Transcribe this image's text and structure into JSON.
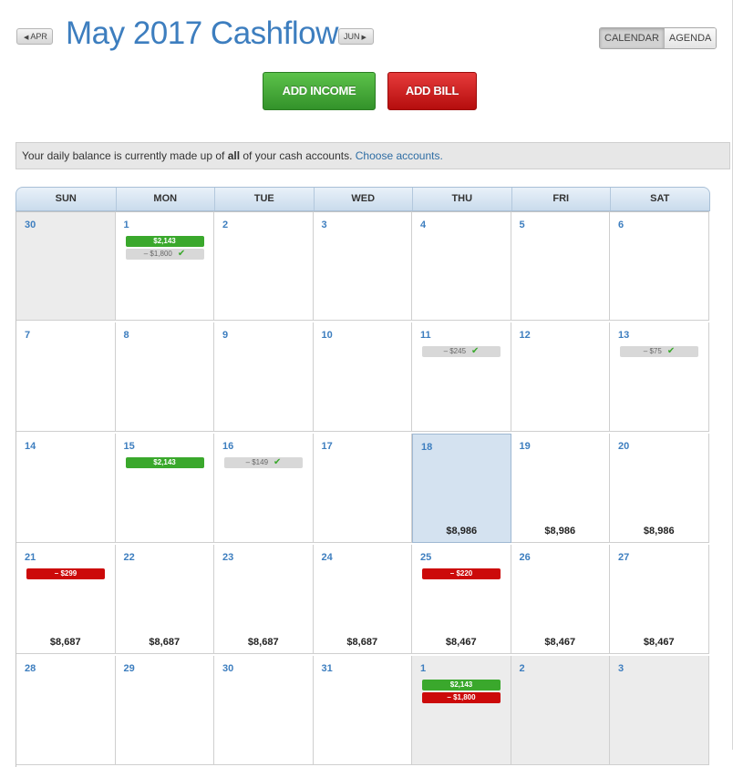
{
  "header": {
    "prev_month": "APR",
    "next_month": "JUN",
    "title": "May 2017 Cashflow",
    "views": [
      "CALENDAR",
      "AGENDA"
    ],
    "active_view": "CALENDAR"
  },
  "actions": {
    "add_income": "ADD INCOME",
    "add_bill": "ADD BILL"
  },
  "info": {
    "text_before": "Your daily balance is currently made up of ",
    "text_bold": "all",
    "text_after": " of your cash accounts. ",
    "link": "Choose accounts."
  },
  "colors": {
    "accent": "#3d7ebf",
    "income": "#3aa82c",
    "bill_due": "#cc0a0a",
    "bill_paid": "#d8d8d8",
    "today": "#d4e2f0"
  },
  "calendar": {
    "days_of_week": [
      "SUN",
      "MON",
      "TUE",
      "WED",
      "THU",
      "FRI",
      "SAT"
    ],
    "weeks": [
      [
        {
          "num": "30",
          "other": true,
          "events": []
        },
        {
          "num": "1",
          "events": [
            {
              "type": "income",
              "label": "$2,143"
            },
            {
              "type": "bill-paid",
              "label": "– $1,800",
              "check": true
            }
          ]
        },
        {
          "num": "2",
          "events": []
        },
        {
          "num": "3",
          "events": []
        },
        {
          "num": "4",
          "events": []
        },
        {
          "num": "5",
          "events": []
        },
        {
          "num": "6",
          "events": []
        }
      ],
      [
        {
          "num": "7",
          "events": []
        },
        {
          "num": "8",
          "events": []
        },
        {
          "num": "9",
          "events": []
        },
        {
          "num": "10",
          "events": []
        },
        {
          "num": "11",
          "events": [
            {
              "type": "bill-paid",
              "label": "– $245",
              "check": true
            }
          ]
        },
        {
          "num": "12",
          "events": []
        },
        {
          "num": "13",
          "events": [
            {
              "type": "bill-paid",
              "label": "– $75",
              "check": true
            }
          ]
        }
      ],
      [
        {
          "num": "14",
          "events": []
        },
        {
          "num": "15",
          "events": [
            {
              "type": "income",
              "label": "$2,143"
            }
          ]
        },
        {
          "num": "16",
          "events": [
            {
              "type": "bill-paid",
              "label": "– $149",
              "check": true
            }
          ]
        },
        {
          "num": "17",
          "events": []
        },
        {
          "num": "18",
          "today": true,
          "events": [],
          "balance": "$8,986"
        },
        {
          "num": "19",
          "events": [],
          "balance": "$8,986"
        },
        {
          "num": "20",
          "events": [],
          "balance": "$8,986"
        }
      ],
      [
        {
          "num": "21",
          "events": [
            {
              "type": "bill-due",
              "label": "– $299"
            }
          ],
          "balance": "$8,687"
        },
        {
          "num": "22",
          "events": [],
          "balance": "$8,687"
        },
        {
          "num": "23",
          "events": [],
          "balance": "$8,687"
        },
        {
          "num": "24",
          "events": [],
          "balance": "$8,687"
        },
        {
          "num": "25",
          "events": [
            {
              "type": "bill-due",
              "label": "– $220"
            }
          ],
          "balance": "$8,467"
        },
        {
          "num": "26",
          "events": [],
          "balance": "$8,467"
        },
        {
          "num": "27",
          "events": [],
          "balance": "$8,467"
        }
      ],
      [
        {
          "num": "28",
          "events": []
        },
        {
          "num": "29",
          "events": []
        },
        {
          "num": "30",
          "events": []
        },
        {
          "num": "31",
          "events": []
        },
        {
          "num": "1",
          "other": true,
          "events": [
            {
              "type": "income",
              "label": "$2,143"
            },
            {
              "type": "bill-due",
              "label": "– $1,800"
            }
          ]
        },
        {
          "num": "2",
          "other": true,
          "events": []
        },
        {
          "num": "3",
          "other": true,
          "events": []
        }
      ]
    ]
  }
}
